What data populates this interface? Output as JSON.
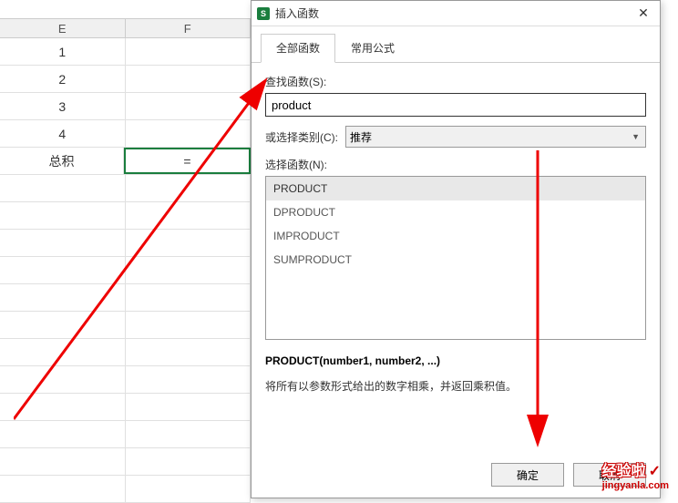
{
  "spreadsheet": {
    "cols": [
      "E",
      "F"
    ],
    "rows": [
      {
        "e": "1",
        "f": ""
      },
      {
        "e": "2",
        "f": ""
      },
      {
        "e": "3",
        "f": ""
      },
      {
        "e": "4",
        "f": ""
      },
      {
        "e": "总积",
        "f": "="
      }
    ]
  },
  "dialog": {
    "title": "插入函数",
    "icon_letter": "S",
    "tabs": {
      "all": "全部函数",
      "common": "常用公式"
    },
    "search_label": "查找函数(S):",
    "search_value": "product",
    "category_label": "或选择类别(C):",
    "category_value": "推荐",
    "select_label": "选择函数(N):",
    "functions": [
      "PRODUCT",
      "DPRODUCT",
      "IMPRODUCT",
      "SUMPRODUCT"
    ],
    "signature": "PRODUCT(number1, number2, ...)",
    "description": "将所有以参数形式给出的数字相乘，并返回乘积值。",
    "ok": "确定",
    "cancel": "取消"
  },
  "watermark": {
    "main": "经验啦",
    "sub": "jingyanla.com"
  }
}
